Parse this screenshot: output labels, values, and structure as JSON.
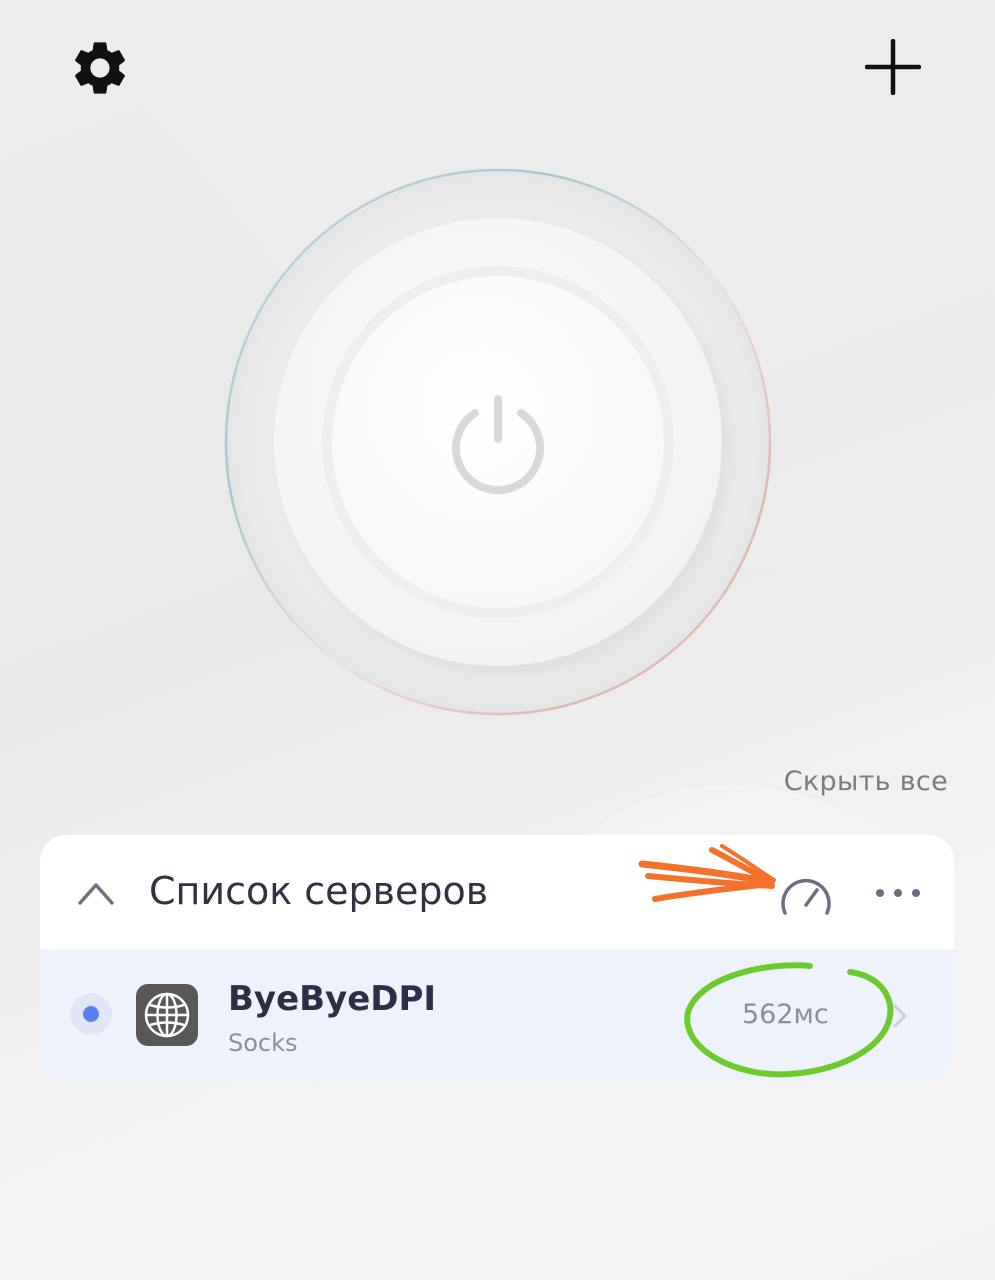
{
  "header": {
    "settings_icon": "gear-icon",
    "add_icon": "plus-icon"
  },
  "connect": {
    "icon": "power-icon"
  },
  "hide_all_label": "Скрыть все",
  "server_list": {
    "title": "Список серверов",
    "collapse_icon": "chevron-up-icon",
    "speed_test_icon": "speedometer-icon",
    "more_icon": "more-horizontal-icon",
    "servers": [
      {
        "name": "ByeByeDPI",
        "type": "Socks",
        "latency": "562мс",
        "icon": "globe-icon",
        "selected": true
      }
    ]
  },
  "annotations": {
    "arrow_color": "#f4722b",
    "circle_color": "#6ecb2e"
  },
  "colors": {
    "accent": "#5b7ff0",
    "title_text": "#2f3240"
  }
}
